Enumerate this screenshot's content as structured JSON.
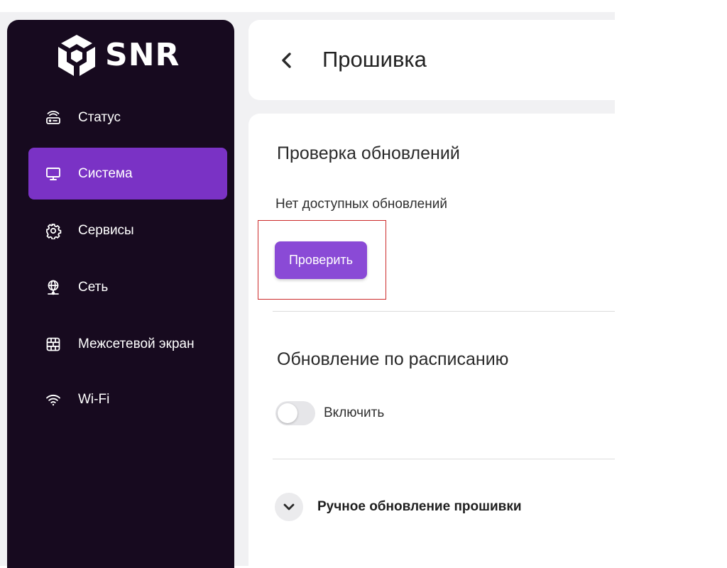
{
  "app": {
    "logo_text": "SNR",
    "accent_color": "#7a32c5",
    "button_color": "#8a4ad6",
    "sidebar_color": "#170a1f"
  },
  "sidebar": {
    "items": [
      {
        "label": "Статус",
        "icon": "router-icon",
        "active": false
      },
      {
        "label": "Система",
        "icon": "monitor-icon",
        "active": true
      },
      {
        "label": "Сервисы",
        "icon": "gear-icon",
        "active": false
      },
      {
        "label": "Сеть",
        "icon": "globe-network-icon",
        "active": false
      },
      {
        "label": "Межсетевой экран",
        "icon": "firewall-icon",
        "active": false
      },
      {
        "label": "Wi-Fi",
        "icon": "wifi-icon",
        "active": false
      }
    ]
  },
  "header": {
    "title": "Прошивка",
    "back_icon": "chevron-left-icon"
  },
  "update_check": {
    "title": "Проверка обновлений",
    "status": "Нет доступных обновлений",
    "button_label": "Проверить"
  },
  "scheduled_update": {
    "title": "Обновление по расписанию",
    "toggle_label": "Включить",
    "toggle_on": false
  },
  "manual_update": {
    "label": "Ручное обновление прошивки",
    "expand_icon": "chevron-down-icon"
  }
}
